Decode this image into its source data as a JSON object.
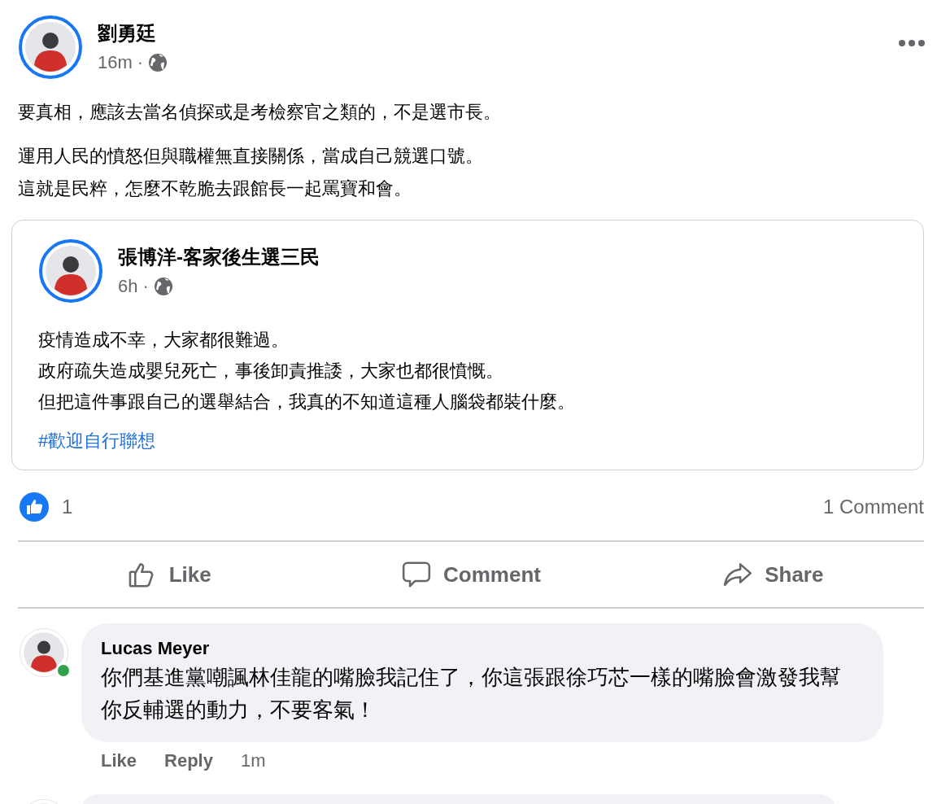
{
  "author": {
    "name": "劉勇廷",
    "time": "16m",
    "separator": "·"
  },
  "paragraphs": [
    [
      "要真相，應該去當名偵探或是考檢察官之類的，不是選市長。"
    ],
    [
      "運用人民的憤怒但與職權無直接關係，當成自己競選口號。",
      "這就是民粹，怎麼不乾脆去跟館長一起罵寶和會。"
    ]
  ],
  "shared_post": {
    "author": {
      "name": "張博洋-客家後生選三民",
      "time": "6h",
      "separator": "·"
    },
    "lines": [
      "疫情造成不幸，大家都很難過。",
      "政府疏失造成嬰兒死亡，事後卸責推諉，大家也都很憤慨。",
      "但把這件事跟自己的選舉結合，我真的不知道這種人腦袋都裝什麼。"
    ],
    "hashtag": "#歡迎自行聯想"
  },
  "reactions": {
    "count": "1",
    "comments": "1 Comment"
  },
  "actions": [
    {
      "kind": "like",
      "label": "Like"
    },
    {
      "kind": "comment",
      "label": "Comment"
    },
    {
      "kind": "share",
      "label": "Share"
    }
  ],
  "comments": [
    {
      "author": "Lucas Meyer",
      "online": true,
      "text": "你們基進黨嘲諷林佳龍的嘴臉我記住了，你這張跟徐巧芯一樣的嘴臉會激發我幫你反輔選的動力，不要客氣！",
      "links": [
        "Like",
        "Reply"
      ],
      "time": "1m"
    }
  ]
}
